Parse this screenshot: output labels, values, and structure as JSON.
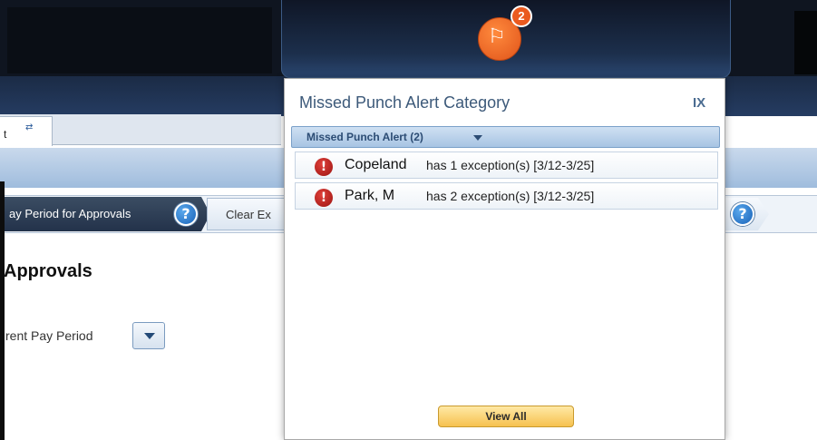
{
  "background": {
    "tab": {
      "label": "t"
    },
    "breadcrumb": {
      "step1": "ay Period for Approvals",
      "step2": "Clear Ex"
    },
    "heading": "Approvals",
    "period_select": {
      "value": "rent Pay Period"
    }
  },
  "notifications": {
    "icon": "missed-punch-alert-icon",
    "count": "2"
  },
  "popup": {
    "title": "Missed Punch Alert Category",
    "close_label": "IX",
    "category": {
      "label": "Missed Punch Alert (2)"
    },
    "alerts": [
      {
        "name": "Copeland",
        "detail": "has 1 exception(s) [3/12-3/25]"
      },
      {
        "name": "Park, M",
        "detail": "has 2 exception(s) [3/12-3/25]"
      }
    ],
    "view_all_label": "View All"
  },
  "colors": {
    "accent_orange": "#e0541a",
    "header_navy": "#1c2f4c",
    "button_gold": "#f6c14f",
    "error_red": "#9c1411"
  }
}
